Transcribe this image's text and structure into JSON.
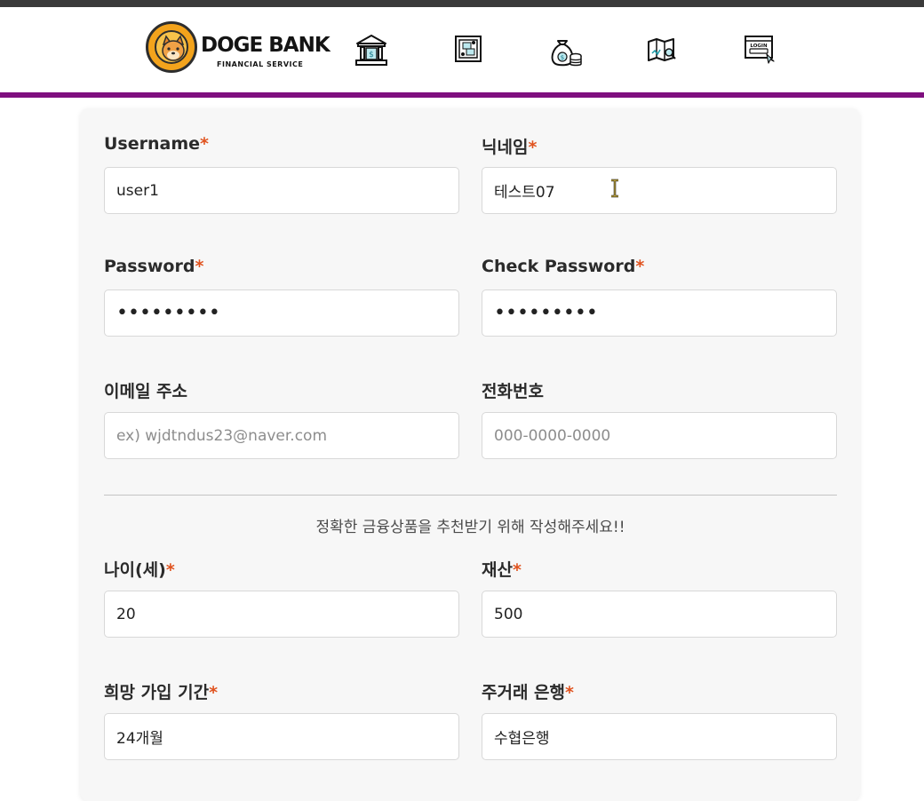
{
  "header": {
    "logo": {
      "title": "DOGE BANK",
      "subtitle": "FINANCIAL SERVICE"
    },
    "nav_icons": [
      {
        "name": "bank-icon"
      },
      {
        "name": "exchange-icon"
      },
      {
        "name": "savings-icon"
      },
      {
        "name": "map-icon"
      },
      {
        "name": "login-icon"
      }
    ],
    "accent_color": "#7f0f7f"
  },
  "form": {
    "username": {
      "label": "Username",
      "required_mark": "*",
      "value": "user1"
    },
    "nickname": {
      "label": "닉네임",
      "required_mark": "*",
      "value": "테스트07"
    },
    "password": {
      "label": "Password",
      "required_mark": "*",
      "value": "•••••••••"
    },
    "check_password": {
      "label": "Check Password",
      "required_mark": "*",
      "value": "•••••••••"
    },
    "email": {
      "label": "이메일 주소",
      "placeholder": "ex) wjdtndus23@naver.com"
    },
    "phone": {
      "label": "전화번호",
      "placeholder": "000-0000-0000"
    },
    "notice": "정확한 금융상품을 추천받기 위해 작성해주세요!!",
    "age": {
      "label": "나이(세)",
      "required_mark": "*",
      "value": "20"
    },
    "assets": {
      "label": "재산",
      "required_mark": "*",
      "value": "500"
    },
    "period": {
      "label": "희망 가입 기간",
      "required_mark": "*",
      "value": "24개월"
    },
    "main_bank": {
      "label": "주거래 은행",
      "required_mark": "*",
      "value": "수협은행"
    }
  }
}
